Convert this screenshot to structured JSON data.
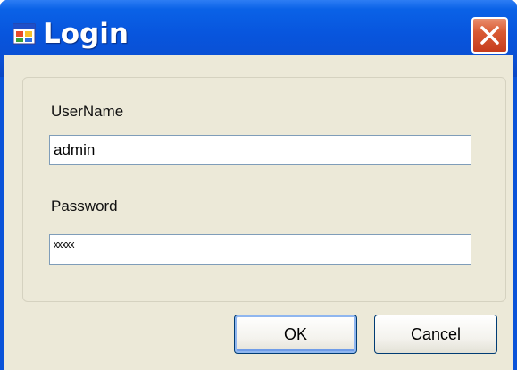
{
  "window": {
    "title": "Login",
    "app_icon": "window-app-icon",
    "close_icon": "close-icon"
  },
  "form": {
    "username_label": "UserName",
    "username_value": "admin",
    "password_label": "Password",
    "password_value": "xxxxx"
  },
  "buttons": {
    "ok_label": "OK",
    "cancel_label": "Cancel"
  },
  "colors": {
    "titlebar": "#0855dd",
    "client_background": "#ece9d8",
    "close_button": "#d95a33",
    "textbox_border": "#7f9db9"
  }
}
